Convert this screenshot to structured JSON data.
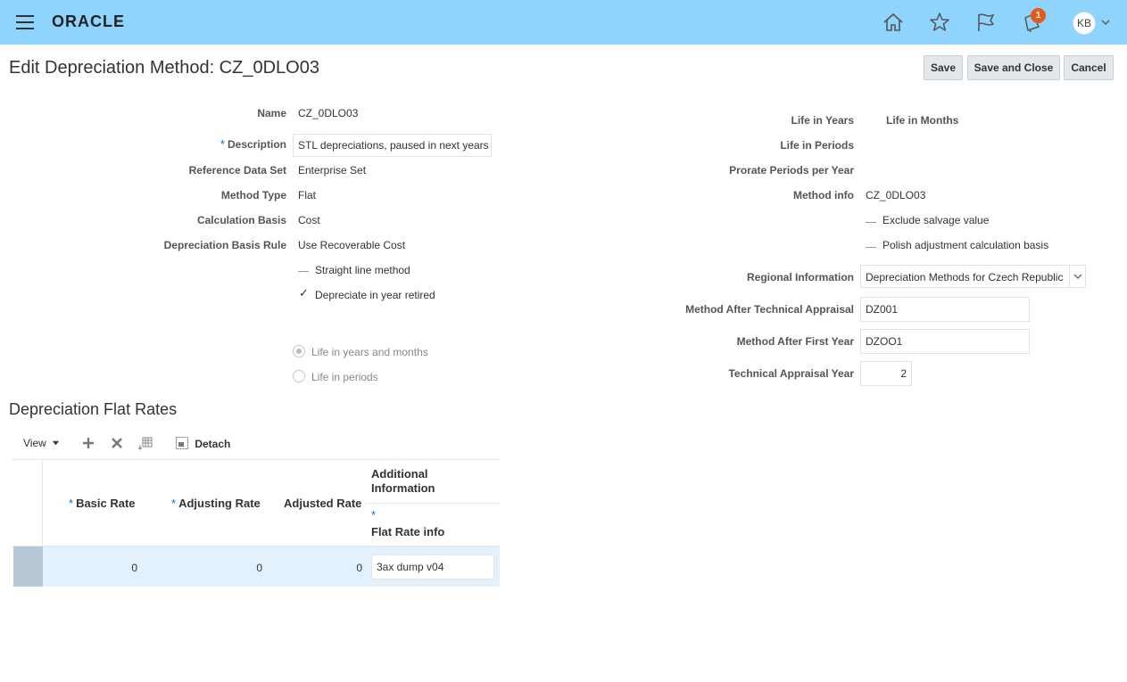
{
  "header": {
    "logo": "ORACLE",
    "notification_count": "1",
    "avatar_initials": "KB"
  },
  "page": {
    "title": "Edit Depreciation Method: CZ_0DLO03",
    "buttons": {
      "save": "Save",
      "save_and_close": "Save and Close",
      "cancel": "Cancel"
    }
  },
  "form_left": {
    "name_label": "Name",
    "name_value": "CZ_0DLO03",
    "description_label": "Description",
    "description_value": "STL depreciations, paused in next years",
    "required_mark": "*",
    "ref_set_label": "Reference Data Set",
    "ref_set_value": "Enterprise Set",
    "method_type_label": "Method Type",
    "method_type_value": "Flat",
    "calc_basis_label": "Calculation Basis",
    "calc_basis_value": "Cost",
    "dep_basis_rule_label": "Depreciation Basis Rule",
    "dep_basis_rule_value": "Use Recoverable Cost",
    "straight_line_label": "Straight line method",
    "dep_year_retired_label": "Depreciate in year retired",
    "life_years_months_label": "Life in years and months",
    "life_periods_label": "Life in periods"
  },
  "form_right": {
    "life_years_label": "Life in Years",
    "life_months_label": "Life in Months",
    "life_periods_label": "Life in Periods",
    "prorate_label": "Prorate Periods per Year",
    "method_info_label": "Method info",
    "method_info_value": "CZ_0DLO03",
    "exclude_salvage_label": "Exclude salvage value",
    "polish_adjustment_label": "Polish adjustment calculation basis",
    "regional_label": "Regional Information",
    "regional_value": "Depreciation Methods for Czech Republic",
    "after_tech_label": "Method After Technical Appraisal",
    "after_tech_value": "DZ001",
    "after_first_label": "Method After First Year",
    "after_first_value": "DZOO1",
    "tech_year_label": "Technical Appraisal Year",
    "tech_year_value": "2"
  },
  "flat_rates": {
    "title": "Depreciation Flat Rates",
    "toolbar": {
      "view": "View",
      "detach": "Detach"
    },
    "columns": {
      "basic_rate": "Basic Rate",
      "adjusting_rate": "Adjusting Rate",
      "adjusted_rate": "Adjusted Rate",
      "additional_info_line1": "Additional",
      "additional_info_line2": "Information",
      "flat_rate_info": "Flat Rate info"
    },
    "rows": [
      {
        "basic_rate": "0",
        "adjusting_rate": "0",
        "adjusted_rate": "0",
        "flat_rate_info": "3ax dump v04"
      }
    ]
  }
}
